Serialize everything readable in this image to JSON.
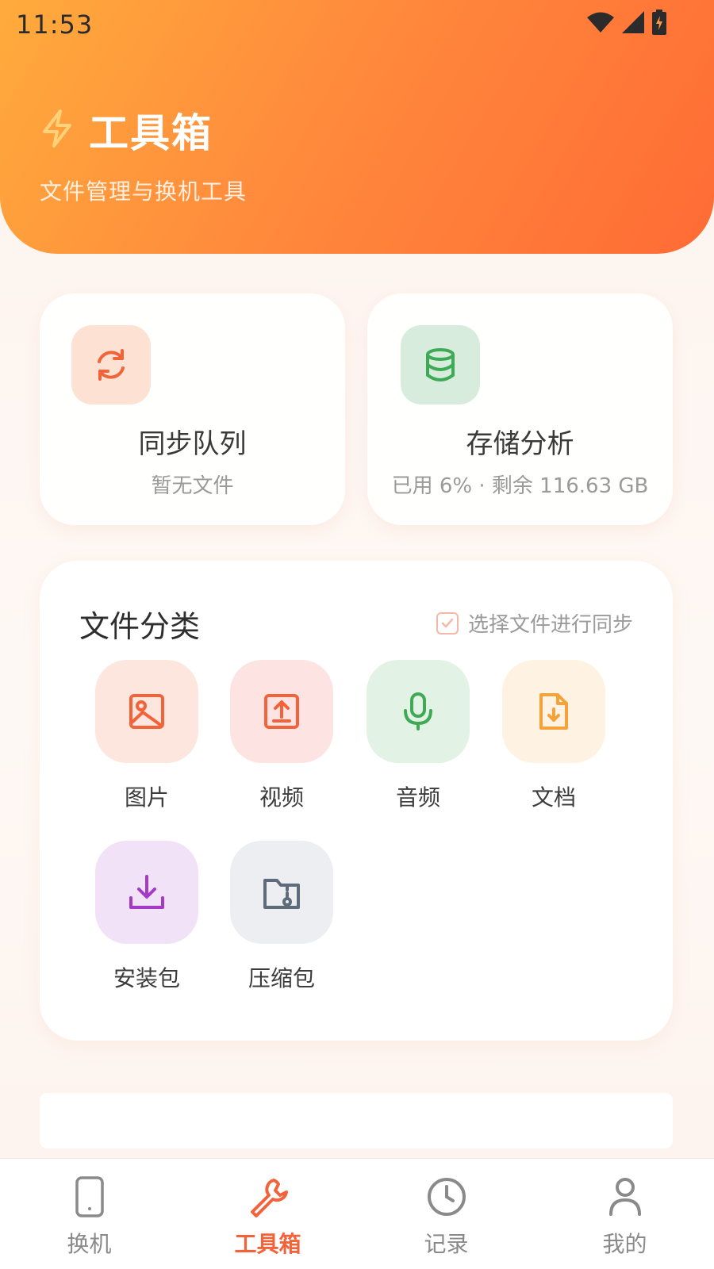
{
  "status_bar": {
    "time": "11:53"
  },
  "header": {
    "title": "工具箱",
    "subtitle": "文件管理与换机工具",
    "icon": "lightning-icon"
  },
  "cards": {
    "sync": {
      "title": "同步队列",
      "subtitle": "暂无文件",
      "icon": "refresh-icon"
    },
    "storage": {
      "title": "存储分析",
      "subtitle": "已用 6% · 剩余 116.63 GB",
      "icon": "database-icon"
    }
  },
  "file_categories": {
    "title": "文件分类",
    "select_label": "选择文件进行同步",
    "items": [
      {
        "label": "图片",
        "icon": "image-icon",
        "color": "#f2633a",
        "bg": "#fde6dd"
      },
      {
        "label": "视频",
        "icon": "video-upload-icon",
        "color": "#f2633a",
        "bg": "#fde4e2"
      },
      {
        "label": "音频",
        "icon": "microphone-icon",
        "color": "#3faa55",
        "bg": "#e2f2e4"
      },
      {
        "label": "文档",
        "icon": "document-download-icon",
        "color": "#f6a23a",
        "bg": "#fef3e2"
      },
      {
        "label": "安装包",
        "icon": "download-icon",
        "color": "#a53ac8",
        "bg": "#f1e2f7"
      },
      {
        "label": "压缩包",
        "icon": "archive-folder-icon",
        "color": "#5d6b7a",
        "bg": "#eceef1"
      }
    ]
  },
  "bottom_nav": {
    "items": [
      {
        "label": "换机",
        "icon": "phone-icon",
        "active": false
      },
      {
        "label": "工具箱",
        "icon": "wrench-icon",
        "active": true
      },
      {
        "label": "记录",
        "icon": "clock-icon",
        "active": false
      },
      {
        "label": "我的",
        "icon": "person-icon",
        "active": false
      }
    ]
  },
  "colors": {
    "accent": "#f2633a",
    "header_gradient_start": "#ffab3c",
    "header_gradient_end": "#ff6b35"
  }
}
